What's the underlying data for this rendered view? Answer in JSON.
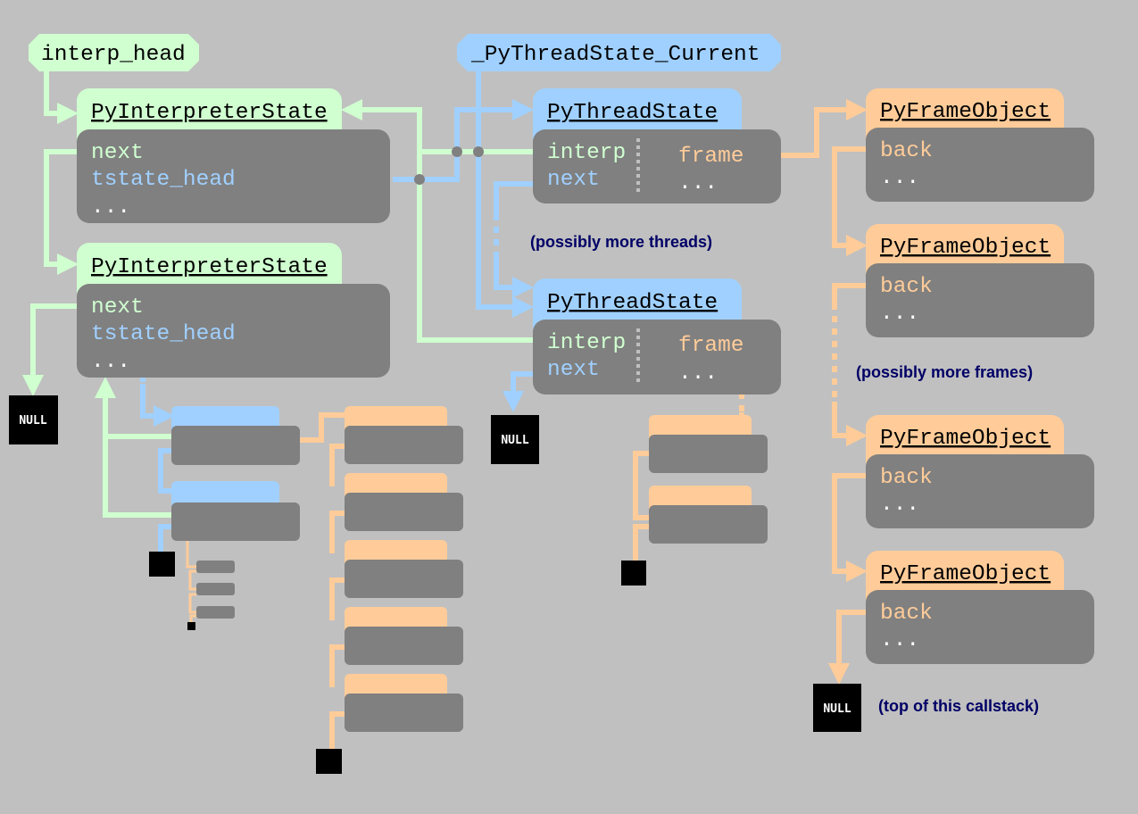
{
  "colors": {
    "background": "#c0c0c0",
    "interpreter": "#d0ffd0",
    "thread": "#a0d0ff",
    "frame": "#ffcc99",
    "body": "#808080",
    "note": "#000066",
    "null_box": "#000000"
  },
  "roots": {
    "interp_head": "interp_head",
    "thread_current": "_PyThreadState_Current"
  },
  "interpreters": [
    {
      "title": "PyInterpreterState",
      "next": "next",
      "tstate_head": "tstate_head",
      "more": "..."
    },
    {
      "title": "PyInterpreterState",
      "next": "next",
      "tstate_head": "tstate_head",
      "more": "..."
    }
  ],
  "threads": [
    {
      "title": "PyThreadState",
      "interp": "interp",
      "next": "next",
      "frame": "frame",
      "more": "..."
    },
    {
      "title": "PyThreadState",
      "interp": "interp",
      "next": "next",
      "frame": "frame",
      "more": "..."
    }
  ],
  "frames": [
    {
      "title": "PyFrameObject",
      "back": "back",
      "more": "..."
    },
    {
      "title": "PyFrameObject",
      "back": "back",
      "more": "..."
    },
    {
      "title": "PyFrameObject",
      "back": "back",
      "more": "..."
    },
    {
      "title": "PyFrameObject",
      "back": "back",
      "more": "..."
    }
  ],
  "notes": {
    "more_threads": "(possibly more threads)",
    "more_frames": "(possibly more frames)",
    "top_of_stack": "(top of this callstack)"
  },
  "null_label": "NULL"
}
